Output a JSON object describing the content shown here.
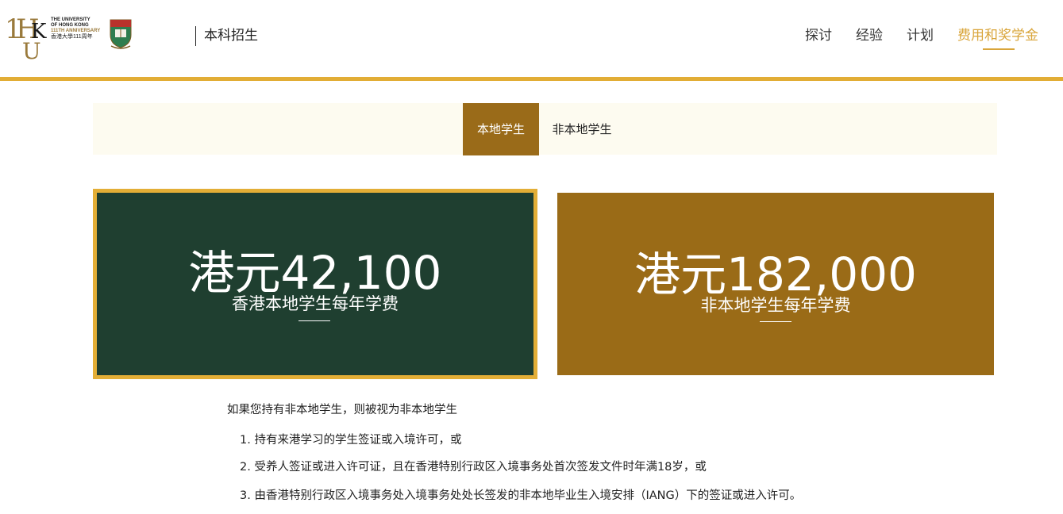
{
  "header": {
    "logo": {
      "line1": "THE UNIVERSITY",
      "line2": "OF HONG KONG",
      "line3": "111TH ANNIVERSARY",
      "line4": "香港大學111周年"
    },
    "section_title": "本科招生",
    "nav": [
      {
        "label": "探讨",
        "active": false
      },
      {
        "label": "经验",
        "active": false
      },
      {
        "label": "计划",
        "active": false
      },
      {
        "label": "费用和奖学金",
        "active": true
      }
    ]
  },
  "tabs": [
    {
      "label": "本地学生",
      "active": true
    },
    {
      "label": "非本地学生",
      "active": false
    }
  ],
  "cards": [
    {
      "amount": "港元42,100",
      "caption": "香港本地学生每年学费"
    },
    {
      "amount": "港元182,000",
      "caption": "非本地学生每年学费"
    }
  ],
  "note": "如果您持有非本地学生，则被视为非本地学生",
  "conditions": [
    "1. 持有来港学习的学生签证或入境许可，或",
    "2. 受养人签证或进入许可证，且在香港特别行政区入境事务处首次签发文件时年满18岁，或",
    "3. 由香港特别行政区入境事务处入境事务处处长签发的非本地毕业生入境安排（IANG）下的签证或进入许可。"
  ],
  "colors": {
    "gold": "#e2ad35",
    "nav_active": "#d9a53a",
    "tab_active_bg": "#9a6b19",
    "local_card_bg": "#1f3f30",
    "nonlocal_card_bg": "#9a6b17"
  }
}
